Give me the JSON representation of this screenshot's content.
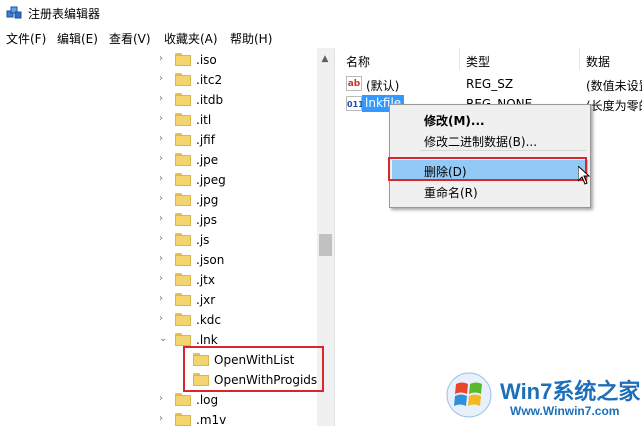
{
  "window": {
    "title": "注册表编辑器"
  },
  "menubar": {
    "items": [
      "文件(F)",
      "编辑(E)",
      "查看(V)",
      "收藏夹(A)",
      "帮助(H)"
    ]
  },
  "tree": {
    "items": [
      {
        "label": ".iso",
        "expand": "collapsed"
      },
      {
        "label": ".itc2",
        "expand": "collapsed"
      },
      {
        "label": ".itdb",
        "expand": "collapsed"
      },
      {
        "label": ".itl",
        "expand": "collapsed"
      },
      {
        "label": ".jfif",
        "expand": "collapsed"
      },
      {
        "label": ".jpe",
        "expand": "collapsed"
      },
      {
        "label": ".jpeg",
        "expand": "collapsed"
      },
      {
        "label": ".jpg",
        "expand": "collapsed"
      },
      {
        "label": ".jps",
        "expand": "collapsed"
      },
      {
        "label": ".js",
        "expand": "collapsed"
      },
      {
        "label": ".json",
        "expand": "collapsed"
      },
      {
        "label": ".jtx",
        "expand": "collapsed"
      },
      {
        "label": ".jxr",
        "expand": "collapsed"
      },
      {
        "label": ".kdc",
        "expand": "collapsed"
      },
      {
        "label": ".lnk",
        "expand": "expanded"
      },
      {
        "label": "OpenWithList",
        "expand": "none",
        "child": true
      },
      {
        "label": "OpenWithProgids",
        "expand": "none",
        "child": true
      },
      {
        "label": ".log",
        "expand": "collapsed"
      },
      {
        "label": ".m1v",
        "expand": "collapsed"
      }
    ]
  },
  "list": {
    "headers": [
      "名称",
      "类型",
      "数据"
    ],
    "rows": [
      {
        "icon": "ab",
        "name": "(默认)",
        "type": "REG_SZ",
        "data": "(数值未设置)"
      },
      {
        "icon": "bin",
        "name": "lnkfile",
        "type": "REG_NONE",
        "data": "(长度为零的二进制值)",
        "selected": true
      }
    ]
  },
  "context_menu": {
    "items": [
      "修改(M)...",
      "修改二进制数据(B)...",
      "删除(D)",
      "重命名(R)"
    ]
  },
  "watermark": {
    "brand": "Win7系统之家",
    "url": "Www.Winwin7.com"
  },
  "colors": {
    "highlight_red": "#d9262c",
    "selection_blue": "#3399ff",
    "menu_hover": "#91c9f7",
    "folder": "#f3d56f"
  }
}
